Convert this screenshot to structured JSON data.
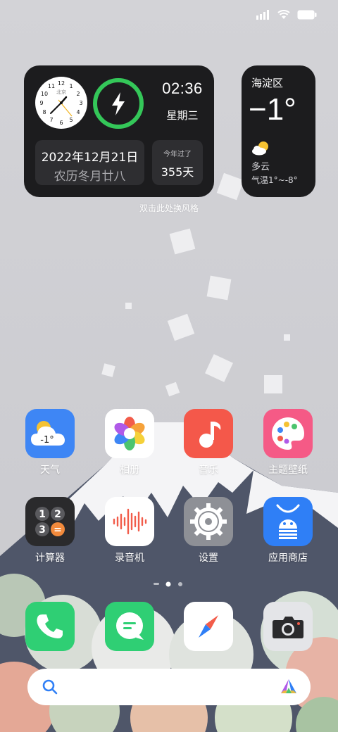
{
  "status_bar": {
    "icons": [
      "signal-icon",
      "wifi-icon",
      "battery-icon"
    ]
  },
  "clock_widget": {
    "analog_city": "北京",
    "analog_numbers": [
      "12",
      "1",
      "2",
      "3",
      "4",
      "5",
      "6",
      "7",
      "8",
      "9",
      "10",
      "11"
    ],
    "digital_time": "02:36",
    "weekday": "星期三",
    "date": "2022年12月21日",
    "lunar_date": "农历冬月廿八",
    "days_label": "今年过了",
    "days_value": "355天",
    "power_icon": "lightning-icon",
    "accent_color": "#34c759"
  },
  "weather_widget": {
    "location": "海淀区",
    "temperature": "−1°",
    "condition": "多云",
    "range": "气温1°~-8°",
    "icon": "partly-cloudy-icon"
  },
  "hint_text": "双击此处换风格",
  "apps_row1": [
    {
      "label": "天气",
      "icon": "weather-icon",
      "icon_text": "-1°",
      "color": "#3e86f5"
    },
    {
      "label": "相册",
      "icon": "photos-icon",
      "color": "#ffffff"
    },
    {
      "label": "音乐",
      "icon": "music-icon",
      "color": "#f4584a"
    },
    {
      "label": "主题壁纸",
      "icon": "theme-palette-icon",
      "color": "#f55a86"
    }
  ],
  "apps_row2": [
    {
      "label": "计算器",
      "icon": "calculator-icon",
      "keys": [
        "1",
        "2",
        "3",
        "="
      ],
      "color": "#2a2a2c"
    },
    {
      "label": "录音机",
      "icon": "recorder-icon",
      "color": "#ffffff"
    },
    {
      "label": "设置",
      "icon": "settings-gear-icon",
      "color": "#8e9096"
    },
    {
      "label": "应用商店",
      "icon": "app-store-icon",
      "color": "#2f7ff6"
    }
  ],
  "page_indicator": {
    "count": 3,
    "active": 2
  },
  "dock": [
    {
      "name": "phone",
      "icon": "phone-icon",
      "color": "#2fcf74"
    },
    {
      "name": "messages",
      "icon": "message-icon",
      "color": "#2fcf74"
    },
    {
      "name": "browser",
      "icon": "compass-icon",
      "color": "#ffffff"
    },
    {
      "name": "camera",
      "icon": "camera-icon",
      "color": "#e4e5e8"
    }
  ],
  "search": {
    "left_icon": "search-icon",
    "right_icon": "assistant-icon"
  }
}
